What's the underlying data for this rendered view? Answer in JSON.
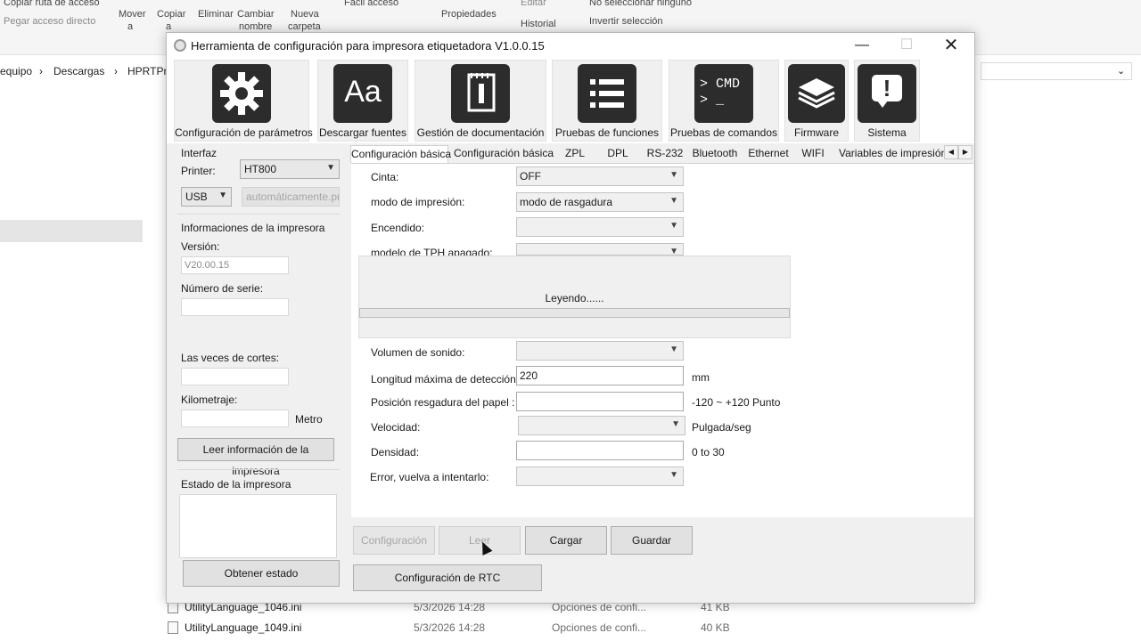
{
  "explorer": {
    "ribbon": {
      "copy_path": "Copiar ruta de acceso",
      "paste_shortcut": "Pegar acceso directo",
      "move": "Mover",
      "move2": "a",
      "copy": "Copiar",
      "copy2": "a",
      "delete": "Eliminar",
      "rename": "Cambiar",
      "rename2": "nombre",
      "new_folder": "Nueva",
      "new_folder2": "carpeta",
      "easy_access": "Fácil acceso",
      "properties": "Propiedades",
      "edit": "Editar",
      "history": "Historial",
      "select_none": "No seleccionar ninguno",
      "invert_selection": "Invertir selección"
    },
    "breadcrumb": [
      "equipo",
      "Descargas",
      "HPRTPri"
    ],
    "files": [
      {
        "name": "UtilityLanguage_1046.ini",
        "date": "5/3/2026 14:28",
        "type": "Opciones de confi...",
        "size": "41 KB"
      },
      {
        "name": "UtilityLanguage_1049.ini",
        "date": "5/3/2026 14:28",
        "type": "Opciones de confi...",
        "size": "40 KB"
      }
    ]
  },
  "dialog": {
    "title": "Herramienta de configuración para impresora etiquetadora  V1.0.0.15",
    "toolbar": [
      {
        "label": "Configuración de parámetros",
        "icon": "gear-icon"
      },
      {
        "label": "Descargar fuentes",
        "icon": "font-icon",
        "glyph": "Aa"
      },
      {
        "label": "Gestión de documentación",
        "icon": "document-icon"
      },
      {
        "label": "Pruebas de funciones",
        "icon": "list-icon"
      },
      {
        "label": "Pruebas de comandos",
        "icon": "cmd-icon",
        "glyph": "> CMD"
      },
      {
        "label": "Firmware",
        "icon": "chip-icon"
      },
      {
        "label": "Sistema",
        "icon": "alert-icon",
        "glyph": "!"
      }
    ],
    "left": {
      "interface_label": "Interfaz",
      "printer_label": "Printer:",
      "printer_value": "HT800",
      "port_value": "USB",
      "port_mode": "automáticamente.pr",
      "info_title": "Informaciones de la impresora",
      "version_label": "Versión:",
      "version_value": "V20.00.15",
      "serial_label": "Número de serie:",
      "cuts_label": "Las veces de cortes:",
      "km_label": "Kilometraje:",
      "km_unit": "Metro",
      "read_info_button": "Leer información de la impresora",
      "status_label": "Estado de la impresora",
      "get_status_button": "Obtener estado"
    },
    "tabs": [
      "Configuración básica",
      "Configuración básica",
      "ZPL",
      "DPL",
      "RS-232",
      "Bluetooth",
      "Ethernet",
      "WIFI",
      "Variables de impresión"
    ],
    "form": {
      "ribbon_label": "Cinta:",
      "ribbon_value": "OFF",
      "print_mode_label": "modo de impresión:",
      "print_mode_value": "modo de rasgadura",
      "power_label": "Encendido:",
      "tph_label": "modelo de TPH apagado:",
      "volume_label": "Volumen de sonido:",
      "max_detect_label": "Longitud máxima de detección:",
      "max_detect_value": "220",
      "max_detect_unit": "mm",
      "tear_pos_label": "Posición resgadura del papel :",
      "tear_pos_unit": "-120 ~ +120 Punto",
      "speed_label": "Velocidad:",
      "speed_unit": "Pulgada/seg",
      "density_label": "Densidad:",
      "density_unit": "0 to 30",
      "error_label": "Error, vuelva a intentarlo:"
    },
    "progress": {
      "message": "Leyendo......",
      "fraction": 0.0
    },
    "actions": {
      "config": "Configuración",
      "read": "Leer",
      "load": "Cargar",
      "save": "Guardar",
      "rtc": "Configuración de RTC"
    }
  }
}
